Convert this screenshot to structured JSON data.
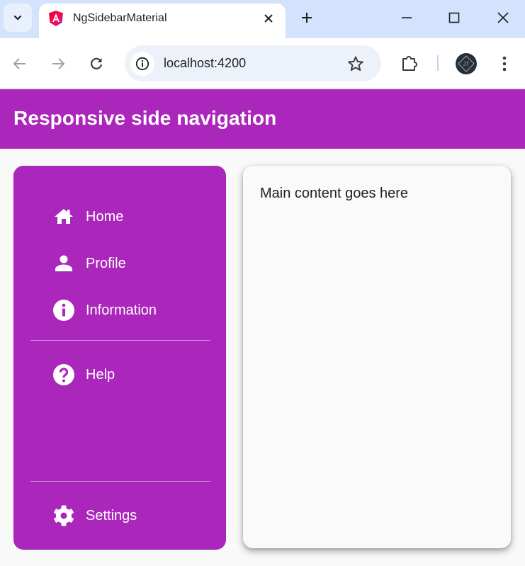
{
  "browser": {
    "tab": {
      "title": "NgSidebarMaterial",
      "favicon": "angular-logo-icon"
    },
    "address_bar": {
      "url": "localhost:4200"
    },
    "profile_initials": "JT",
    "colors": {
      "tabstrip": "#d3e3fd",
      "omnibox": "#edf2fa"
    }
  },
  "app": {
    "header": {
      "title": "Responsive side navigation"
    },
    "sidenav": {
      "items": [
        {
          "label": "Home",
          "icon": "home-icon"
        },
        {
          "label": "Profile",
          "icon": "person-icon"
        },
        {
          "label": "Information",
          "icon": "info-icon"
        },
        {
          "label": "Help",
          "icon": "help-icon"
        }
      ],
      "footer_items": [
        {
          "label": "Settings",
          "icon": "settings-icon"
        }
      ]
    },
    "main": {
      "text": "Main content goes here"
    },
    "colors": {
      "primary": "#ab27bb",
      "background": "#f9f9f9",
      "card": "#fafafa"
    }
  }
}
